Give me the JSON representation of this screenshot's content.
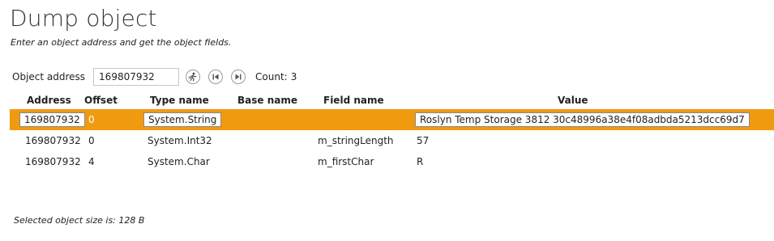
{
  "page": {
    "title": "Dump object",
    "subtitle": "Enter an object address and get the object fields."
  },
  "toolbar": {
    "address_label": "Object address",
    "address_value": "169807932",
    "count_label": "Count:",
    "count_value": "3",
    "icons": [
      "dump-run-icon",
      "first-record-icon",
      "last-record-icon"
    ]
  },
  "grid": {
    "columns": [
      "Address",
      "Offset",
      "Type name",
      "Base name",
      "Field name",
      "Value"
    ],
    "rows": [
      {
        "address": "169807932",
        "offset": "0",
        "type_name": "System.String",
        "base_name": "",
        "field_name": "",
        "value": "Roslyn Temp Storage 3812 30c48996a38e4f08adbda5213dcc69d7",
        "selected": true
      },
      {
        "address": "169807932",
        "offset": "0",
        "type_name": "System.Int32",
        "base_name": "",
        "field_name": "m_stringLength",
        "value": "57",
        "selected": false
      },
      {
        "address": "169807932",
        "offset": "4",
        "type_name": "System.Char",
        "base_name": "",
        "field_name": "m_firstChar",
        "value": "R",
        "selected": false
      }
    ],
    "selection_color": "#f09a10"
  },
  "footer": {
    "text": "Selected object size is: 128 B"
  }
}
